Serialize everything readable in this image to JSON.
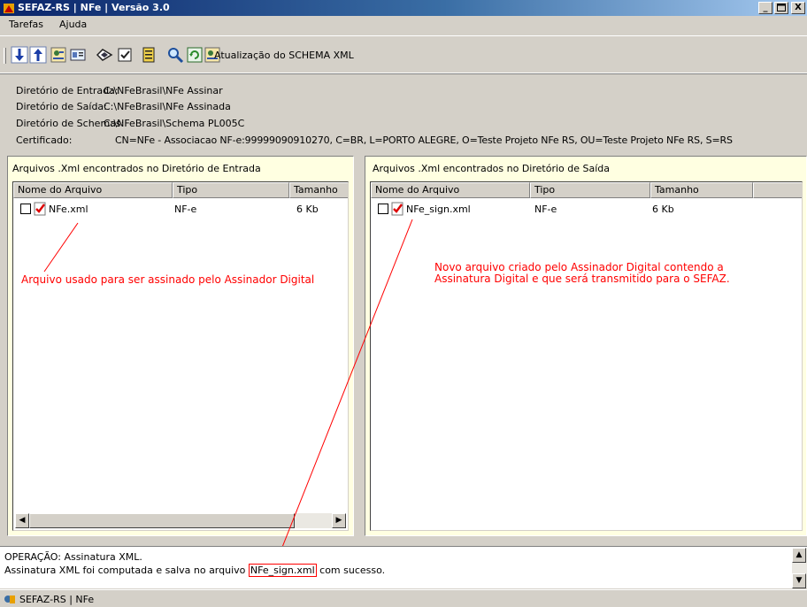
{
  "window": {
    "title": "SEFAZ-RS | NFe | Versão 3.0",
    "buttons": {
      "minimize": "_",
      "maximize": "▫",
      "close": "X"
    }
  },
  "menu": [
    "Tarefas",
    "Ajuda"
  ],
  "toolbar": {
    "icons": [
      "download-icon",
      "upload-icon",
      "certificate-icon",
      "id-card-icon",
      "sign-icon",
      "checklist-icon",
      "document-icon",
      "magnifier-icon",
      "refresh-icon",
      "schema-icon"
    ],
    "schema_update_label": "Atualização do SCHEMA XML"
  },
  "info": {
    "entrada_label": "Diretório de Entrada:",
    "entrada_value": "C:\\NFeBrasil\\NFe Assinar",
    "saida_label": "Diretório de Saída:",
    "saida_value": "C:\\NFeBrasil\\NFe Assinada",
    "schemas_label": "Diretório de Schemas:",
    "schemas_value": "C:\\NFeBrasil\\Schema PL005C",
    "certificado_label": "Certificado:",
    "certificado_value": "CN=NFe - Associacao NF-e:99999090910270, C=BR, L=PORTO ALEGRE, O=Teste Projeto NFe RS, OU=Teste Projeto NFe RS, S=RS"
  },
  "left_panel": {
    "caption": "Arquivos .Xml encontrados no Diretório de Entrada",
    "columns": [
      "Nome do Arquivo",
      "Tipo",
      "Tamanho"
    ],
    "rows": [
      {
        "name": "NFe.xml",
        "tipo": "NF-e",
        "tamanho": "6 Kb"
      }
    ]
  },
  "right_panel": {
    "caption": "Arquivos .Xml encontrados no Diretório de Saída",
    "columns": [
      "Nome do Arquivo",
      "Tipo",
      "Tamanho"
    ],
    "rows": [
      {
        "name": "NFe_sign.xml",
        "tipo": "NF-e",
        "tamanho": "6 Kb"
      }
    ]
  },
  "annotations": {
    "left": "Arquivo usado para ser assinado pelo Assinador Digital",
    "right": "Novo arquivo criado pelo Assinador Digital contendo a\nAssinatura Digital e que será transmitido para o SEFAZ.",
    "color": "#ff0000"
  },
  "log": {
    "line1": "OPERAÇÃO: Assinatura XML.",
    "line2_prefix": "Assinatura XML foi computada e salva no arquivo",
    "line2_file": "NFe_sign.xml",
    "line2_suffix": "com sucesso."
  },
  "status": {
    "text": "SEFAZ-RS | NFe"
  },
  "colors": {
    "title_gradient_start": "#0a246a",
    "title_gradient_end": "#a6caf0",
    "panel_background": "#ffffe1",
    "window_background": "#d4d0c8"
  }
}
